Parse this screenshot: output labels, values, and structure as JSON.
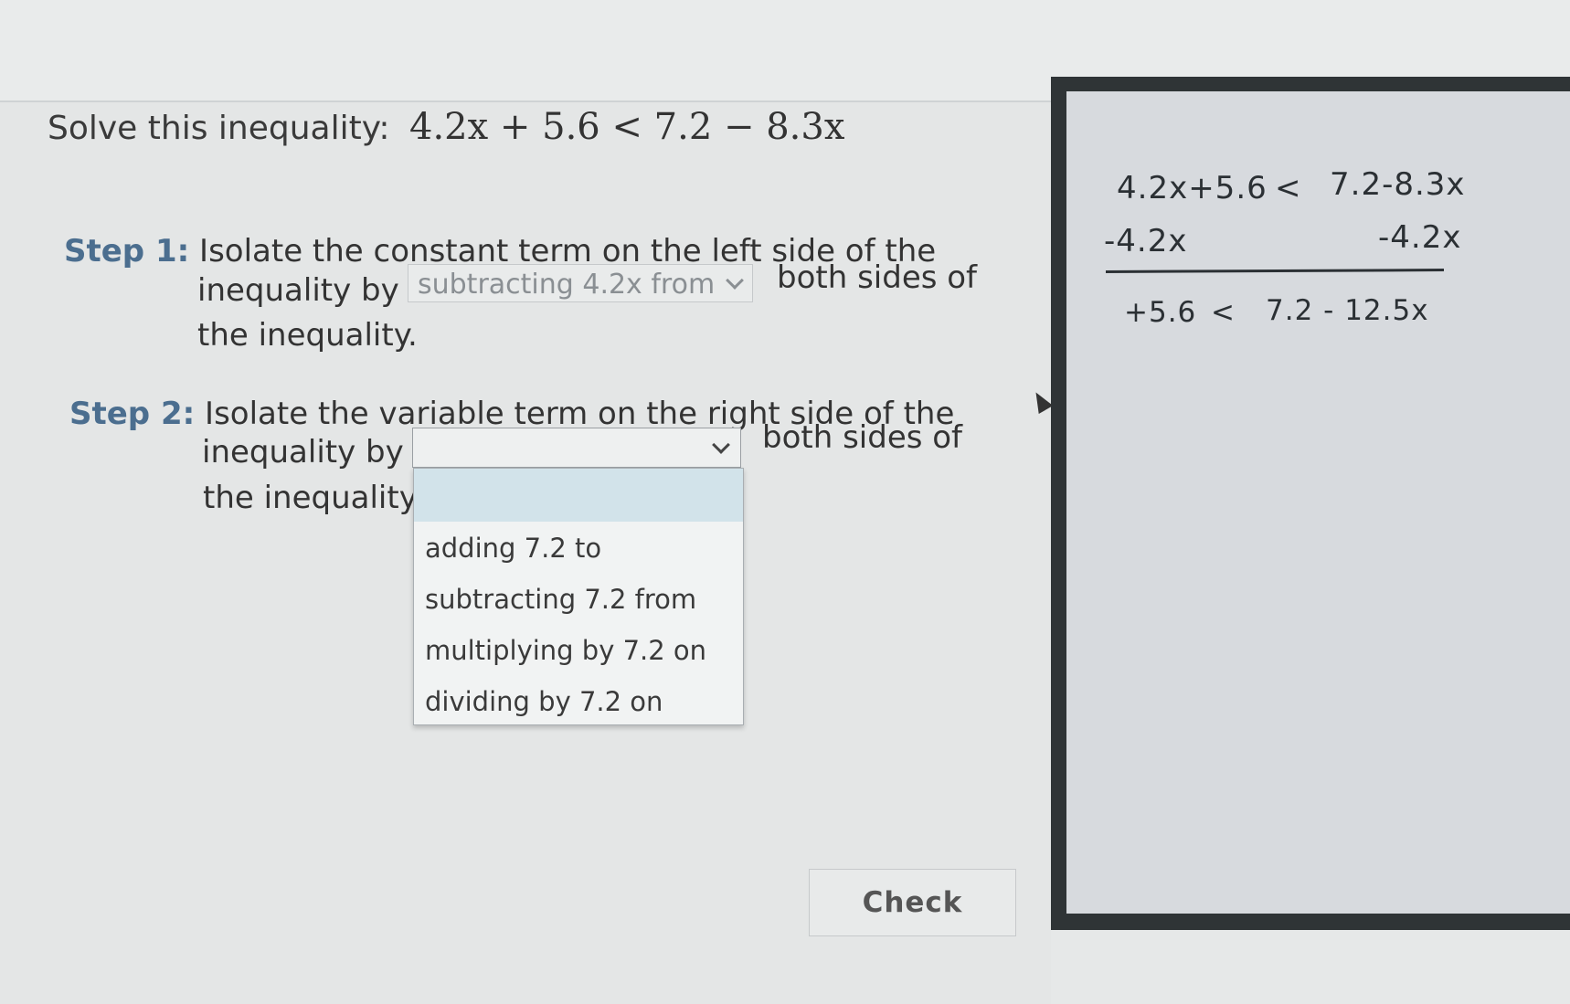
{
  "question": {
    "label": "Solve this inequality:",
    "inequality": "4.2x + 5.6 < 7.2 − 8.3x"
  },
  "step1": {
    "label": "Step 1:",
    "line1": "Isolate the constant term on the left side of the",
    "line2_prefix": "inequality by",
    "selected": "subtracting 4.2x from",
    "line2_suffix": "both sides of",
    "line3": "the inequality."
  },
  "step2": {
    "label": "Step 2:",
    "line1": "Isolate the variable term on the right side of the",
    "line2_prefix": "inequality by",
    "selected": "",
    "line2_suffix": "both sides of",
    "line3": "the inequality",
    "options": [
      "adding 7.2 to",
      "subtracting 7.2 from",
      "multiplying by 7.2 on",
      "dividing by 7.2 on"
    ]
  },
  "check_button": {
    "label": "Check"
  },
  "scratch_work": {
    "line1_left": "4.2x+5.6",
    "line1_op": "<",
    "line1_right": "7.2-8.3x",
    "line2_left": "-4.2x",
    "line2_right": "-4.2x",
    "line3_left": "+5.6",
    "line3_op": "<",
    "line3_right": "7.2 - 12.5x"
  },
  "colors": {
    "step_label": "#4b6e8f",
    "dropdown_highlight": "#d2e3ea"
  }
}
